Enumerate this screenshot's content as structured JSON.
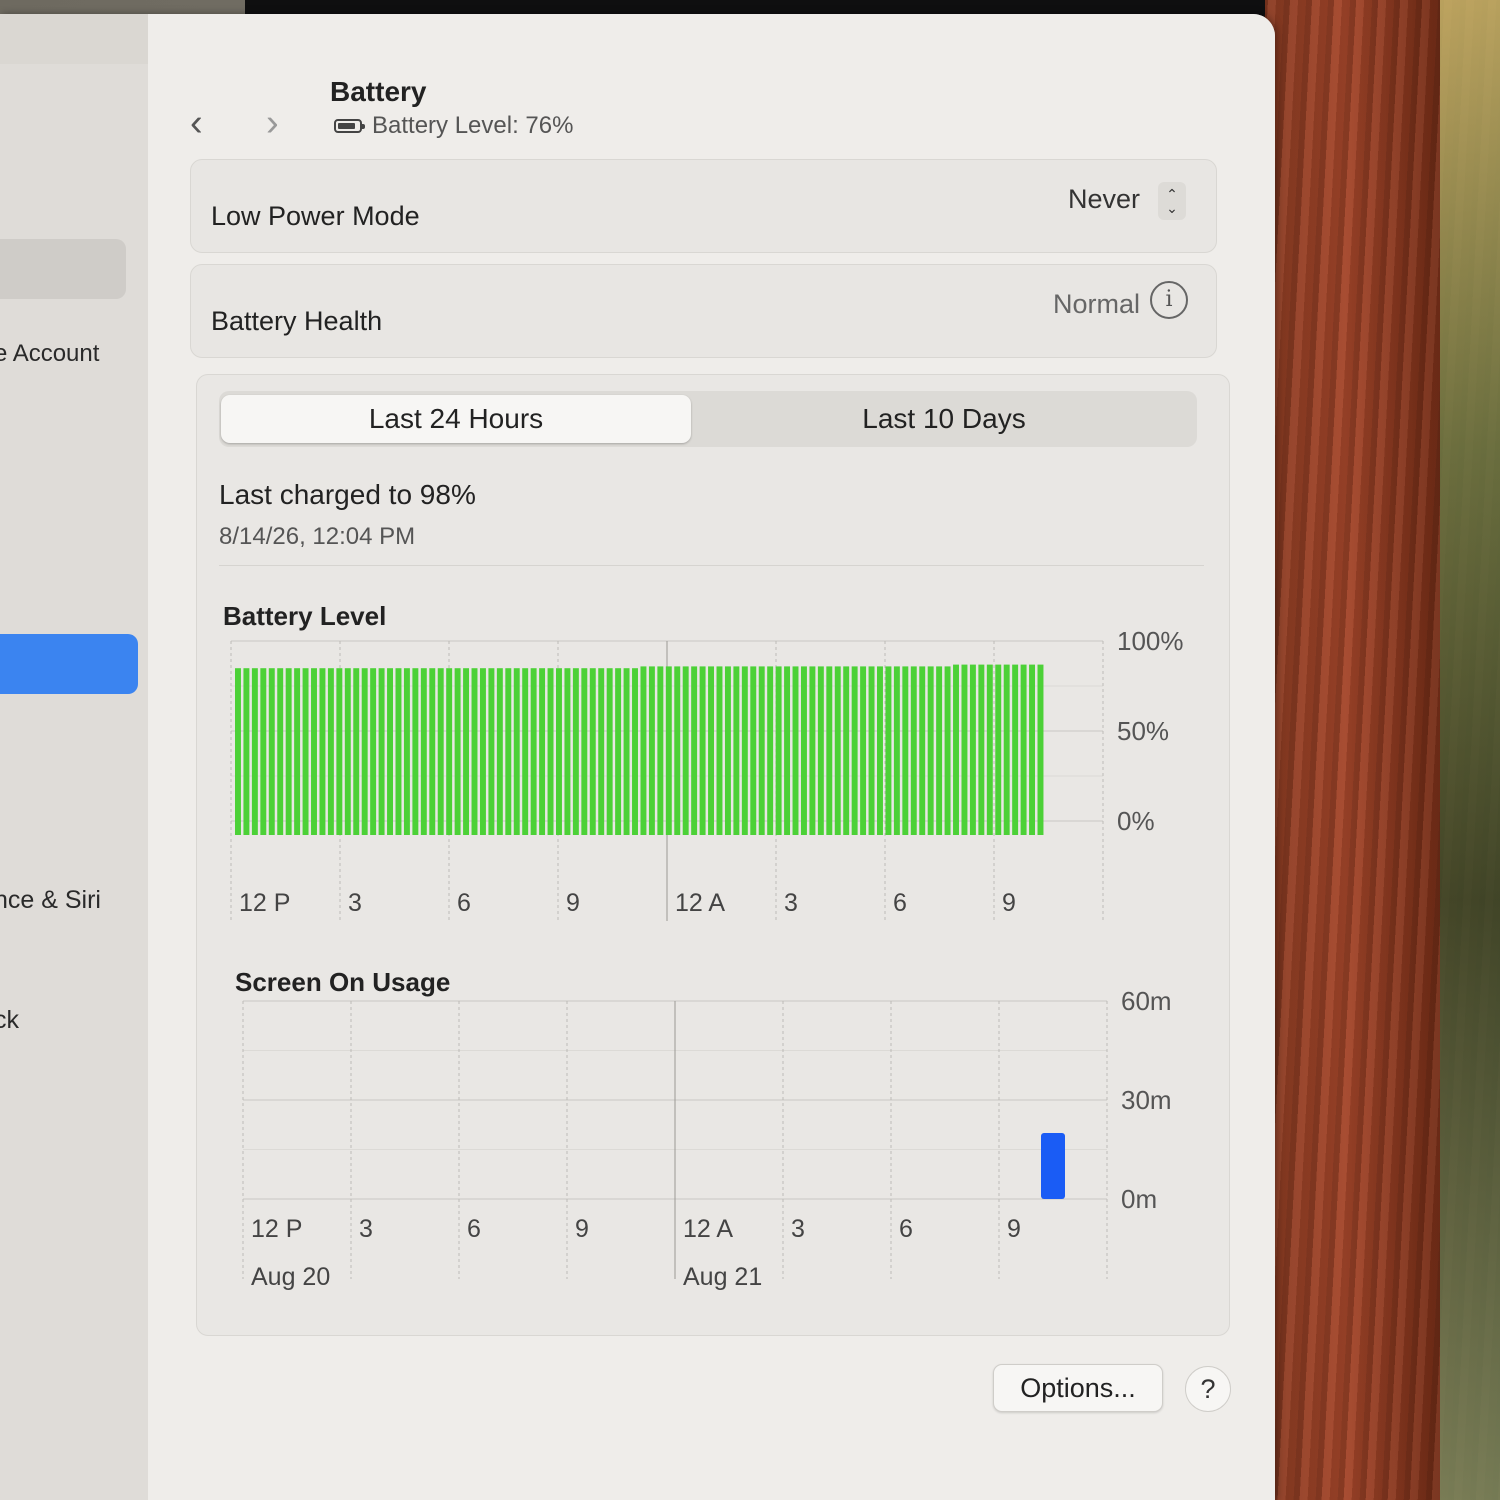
{
  "sidebar": {
    "items": [
      {
        "label": "e Account"
      },
      {
        "label": "nce & Siri"
      },
      {
        "label": "ck"
      }
    ]
  },
  "header": {
    "back_icon": "chevron-left-icon",
    "forward_icon": "chevron-right-icon",
    "title": "Battery",
    "subtitle": "Battery Level: 76%"
  },
  "low_power_mode": {
    "label": "Low Power Mode",
    "value": "Never"
  },
  "battery_health": {
    "label": "Battery Health",
    "value": "Normal"
  },
  "tabs": [
    {
      "label": "Last 24 Hours",
      "selected": true
    },
    {
      "label": "Last 10 Days",
      "selected": false
    }
  ],
  "last_charged": {
    "text": "Last charged to 98%",
    "date": "8/14/26, 12:04 PM"
  },
  "footer": {
    "options_label": "Options...",
    "help_label": "?"
  },
  "colors": {
    "battery_bar": "#4cd137",
    "usage_bar": "#1a5cf5",
    "selection": "#3b84f0"
  },
  "chart_data": [
    {
      "type": "bar",
      "title": "Battery Level",
      "ylabel": "",
      "yticks": [
        "100%",
        "50%",
        "0%"
      ],
      "ylim": [
        0,
        100
      ],
      "x_ticks": [
        "12 P",
        "3",
        "6",
        "9",
        "12 A",
        "3",
        "6",
        "9"
      ],
      "bar_count": 96,
      "values_start": 76,
      "values_end": 78,
      "series": [
        {
          "values": [
            76,
            76,
            76,
            76,
            76,
            76,
            76,
            76,
            76,
            76,
            76,
            76,
            76,
            76,
            76,
            76,
            76,
            76,
            76,
            76,
            76,
            76,
            76,
            76,
            76,
            76,
            76,
            76,
            76,
            76,
            76,
            76,
            76,
            76,
            76,
            76,
            76,
            76,
            76,
            76,
            76,
            76,
            76,
            76,
            76,
            76,
            76,
            76,
            77,
            77,
            77,
            77,
            77,
            77,
            77,
            77,
            77,
            77,
            77,
            77,
            77,
            77,
            77,
            77,
            77,
            77,
            77,
            77,
            77,
            77,
            77,
            77,
            77,
            77,
            77,
            77,
            77,
            77,
            77,
            77,
            77,
            77,
            77,
            77,
            77,
            78,
            78,
            78,
            78,
            78,
            78,
            78,
            78,
            78,
            78,
            78
          ]
        }
      ]
    },
    {
      "type": "bar",
      "title": "Screen On Usage",
      "yticks": [
        "60m",
        "30m",
        "0m"
      ],
      "ylim": [
        0,
        60
      ],
      "x_ticks": [
        "12 P",
        "3",
        "6",
        "9",
        "12 A",
        "3",
        "6",
        "9"
      ],
      "date_labels": [
        "Aug 20",
        "Aug 21"
      ],
      "series": [
        {
          "values": [
            0,
            0,
            0,
            0,
            0,
            0,
            0,
            0,
            0,
            0,
            0,
            0,
            0,
            0,
            0,
            0,
            0,
            0,
            0,
            0,
            0,
            0,
            20,
            0
          ]
        }
      ]
    }
  ]
}
